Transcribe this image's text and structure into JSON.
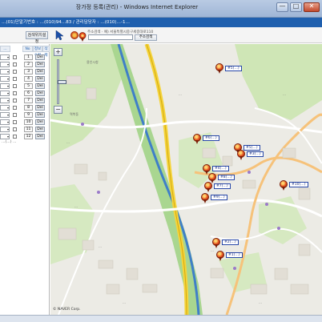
{
  "window": {
    "title": "장가정 등록(관리) - Windows Internet Explorer",
    "minimize_glyph": "—",
    "maximize_glyph": "□",
    "close_glyph": "✕"
  },
  "infobar": {
    "text": "…(01)단말기번호 : …(010)94…83 / 관리담당자 : …(010)…-1…"
  },
  "toolbar": {
    "address_search_label": "검색위치설정",
    "emblem_icon": "municipal-emblem-icon",
    "pointer_icon": "pointer-arrow-icon",
    "pin_icon": "map-pin-icon",
    "search_hint": "주소검색 · 예) 서울특별시중구세종대로110",
    "search_value": "",
    "search_button_label": "주소검색"
  },
  "left_panel": {
    "headers": [
      "…",
      "No",
      "정보수정",
      "삭제"
    ],
    "rows": [
      {
        "select": "",
        "num": "1",
        "action": "Del"
      },
      {
        "select": "",
        "num": "2",
        "action": "Del"
      },
      {
        "select": "",
        "num": "3",
        "action": "Del"
      },
      {
        "select": "",
        "num": "4",
        "action": "Del"
      },
      {
        "select": "",
        "num": "5",
        "action": "Del"
      },
      {
        "select": "",
        "num": "6",
        "action": "Del"
      },
      {
        "select": "",
        "num": "7",
        "action": "Del"
      },
      {
        "select": "",
        "num": "8",
        "action": "Del"
      },
      {
        "select": "",
        "num": "9",
        "action": "Del"
      },
      {
        "select": "",
        "num": "10",
        "action": "Del"
      },
      {
        "select": "",
        "num": "11",
        "action": "Del"
      },
      {
        "select": "",
        "num": "12",
        "action": "Del"
      }
    ],
    "note": "…(…)  …"
  },
  "map": {
    "zoom_in": "+",
    "zoom_out": "−",
    "zoom_level": 0.5,
    "copyright": "© NAVER Corp.",
    "pins": [
      {
        "label": "#5(…)"
      },
      {
        "label": "#6(…)"
      },
      {
        "label": "#5(…)"
      },
      {
        "label": "#3(…)"
      },
      {
        "label": "#4(…)"
      },
      {
        "label": "#8(…)"
      },
      {
        "label": "#7(…)"
      },
      {
        "label": "#10(…)"
      },
      {
        "label": "#9(…)"
      },
      {
        "label": "#2(…)"
      },
      {
        "label": "#1(…)"
      }
    ],
    "places": [
      "용인시청",
      "역북동",
      "…",
      "…",
      "…",
      "…",
      "…",
      "…",
      "…",
      "…"
    ]
  },
  "colors": {
    "infobar": "#1f5fae",
    "pin": "#e24a1b",
    "pin_label_border": "#2747a8",
    "park": "#b9db9c",
    "highway": "#f5d43b"
  }
}
